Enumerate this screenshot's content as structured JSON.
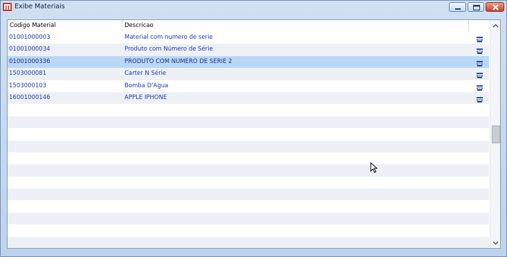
{
  "window": {
    "title": "Exibe Materiais",
    "icons": {
      "app": "app-logo-icon",
      "minimize": "minimize-icon",
      "maximize": "maximize-icon",
      "close": "close-icon"
    }
  },
  "grid": {
    "columns": [
      "Codigo Material",
      "Descricao",
      ""
    ],
    "rows": [
      {
        "code": "01001000003",
        "description": "Material com numero de serie",
        "icon": "printer-icon",
        "selected": false
      },
      {
        "code": "01001000034",
        "description": "Produto com Número de Série",
        "icon": "printer-icon",
        "selected": false
      },
      {
        "code": "01001000336",
        "description": "PRODUTO COM NUMERO DE SERIE 2",
        "icon": "printer-icon",
        "selected": true
      },
      {
        "code": "1503000081",
        "description": "Carter N Série",
        "icon": "printer-icon",
        "selected": false
      },
      {
        "code": "1503000103",
        "description": "Bomba D'Agua",
        "icon": "printer-icon",
        "selected": false
      },
      {
        "code": "16001000146",
        "description": "APPLE IPHONE",
        "icon": "printer-icon",
        "selected": false
      }
    ]
  },
  "colors": {
    "link_text": "#1f36a8",
    "selected_row": "#b9d8f5",
    "stripe_row": "#edf1f6"
  }
}
